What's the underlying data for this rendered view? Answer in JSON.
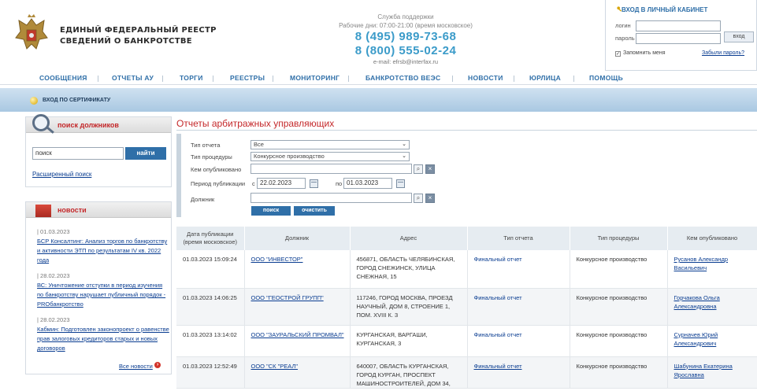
{
  "header": {
    "title_line1": "ЕДИНЫЙ ФЕДЕРАЛЬНЫЙ РЕЕСТР",
    "title_line2": "СВЕДЕНИЙ О БАНКРОТСТВЕ",
    "support_label": "Служба поддержки",
    "support_hours": "Рабочие дни: 07:00-21:00 (время московское)",
    "phone1": "8 (495) 989-73-68",
    "phone2": "8 (800) 555-02-24",
    "email": "e-mail: efrsb@interfax.ru"
  },
  "login": {
    "title": "ВХОД В ЛИЧНЫЙ КАБИНЕТ",
    "login_label": "логин",
    "password_label": "пароль",
    "enter_button": "вход",
    "remember_label": "Запомнить меня",
    "forgot_link": "Забыли пароль?"
  },
  "menu": {
    "items": [
      "СООБЩЕНИЯ",
      "ОТЧЕТЫ АУ",
      "ТОРГИ",
      "РЕЕСТРЫ",
      "МОНИТОРИНГ",
      "БАНКРОТСТВО ВЕЭС",
      "НОВОСТИ",
      "ЮРЛИЦА",
      "ПОМОЩЬ"
    ]
  },
  "cert": {
    "label": "ВХОД ПО СЕРТИФИКАТУ"
  },
  "debtor_search": {
    "title": "поиск должников",
    "input_value": "поиск",
    "button": "найти",
    "advanced_link": "Расширенный поиск"
  },
  "news": {
    "title": "новости",
    "items": [
      {
        "date": "| 01.03.2023",
        "text": "БСР Консалтинг: Анализ торгов по банкротству и активности ЭТП по результатам IV кв. 2022 года"
      },
      {
        "date": "| 28.02.2023",
        "text": "ВС: Уничтожение отступки в период изучения по банкротству нарушает публичный порядок - PROбанкротство"
      },
      {
        "date": "| 28.02.2023",
        "text": "Кабмин: Подготовлен законопроект о равенстве прав залоговых кредиторов старых и новых договоров"
      }
    ],
    "all_link": "Все новости"
  },
  "main": {
    "title": "Отчеты арбитражных управляющих",
    "filter": {
      "report_type_label": "Тип отчета",
      "report_type_value": "Все",
      "procedure_label": "Тип процедуры",
      "procedure_value": "Конкурсное производство",
      "publisher_label": "Кем опубликовано",
      "period_label": "Период публикации",
      "from_label": "с",
      "date_from": "22.02.2023",
      "to_label": "по",
      "date_to": "01.03.2023",
      "debtor_label": "Должник",
      "search_button": "поиск",
      "clear_button": "очистить"
    },
    "table": {
      "headers": [
        "Дата публикации (время московское)",
        "Должник",
        "Адрес",
        "Тип отчета",
        "Тип процедуры",
        "Кем опубликовано"
      ],
      "rows": [
        {
          "date": "01.03.2023 15:09:24",
          "debtor": "ООО \"ИНВЕСТОР\"",
          "address": "456871, ОБЛАСТЬ ЧЕЛЯБИНСКАЯ, ГОРОД СНЕЖИНСК, УЛИЦА СНЕЖНАЯ, 15",
          "report": "Финальный отчет",
          "procedure": "Конкурсное производство",
          "publisher": "Русанов Александр Васильевич"
        },
        {
          "date": "01.03.2023 14:06:25",
          "debtor": "ООО \"ГЕОСТРОЙ ГРУПП\"",
          "address": "117246, ГОРОД МОСКВА, ПРОЕЗД НАУЧНЫЙ, ДОМ 8, СТРОЕНИЕ 1, ПОМ. XVIII К. 3",
          "report": "Финальный отчет",
          "procedure": "Конкурсное производство",
          "publisher": "Горчакова Ольга Александровна"
        },
        {
          "date": "01.03.2023 13:14:02",
          "debtor": "ООО \"ЗАУРАЛЬСКИЙ ПРОМВАЛ\"",
          "address": "КУРГАНСКАЯ, ВАРГАШИ, КУРГАНСКАЯ, 3",
          "report": "Финальный отчет",
          "procedure": "Конкурсное производство",
          "publisher": "Сурначев Юрий Александрович"
        },
        {
          "date": "01.03.2023 12:52:49",
          "debtor": "ООО \"СК \"РЕАЛ\"",
          "address": "640007, ОБЛАСТЬ КУРГАНСКАЯ, ГОРОД КУРГАН, ПРОСПЕКТ МАШИНОСТРОИТЕЛЕЙ, ДОМ 34,",
          "report": "Финальный отчет",
          "procedure": "Конкурсное производство",
          "publisher": "Шабунина Екатерина Ярославна"
        }
      ]
    }
  }
}
